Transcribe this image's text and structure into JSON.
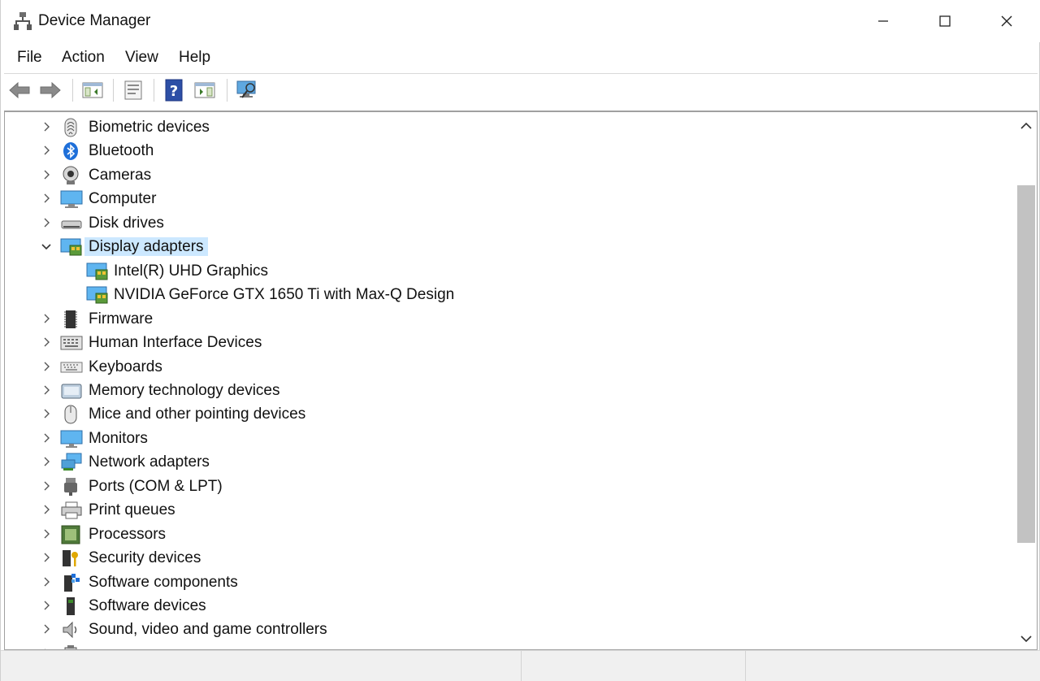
{
  "window": {
    "title": "Device Manager"
  },
  "menu": {
    "file": "File",
    "action": "Action",
    "view": "View",
    "help": "Help"
  },
  "toolbar_icons": [
    "back-arrow-icon",
    "forward-arrow-icon",
    "show-hide-console-tree-icon",
    "properties-icon",
    "help-icon",
    "update-driver-icon",
    "scan-hardware-changes-icon"
  ],
  "tree": {
    "categories": [
      {
        "label": "Biometric devices",
        "icon": "fingerprint-icon"
      },
      {
        "label": "Bluetooth",
        "icon": "bluetooth-icon"
      },
      {
        "label": "Cameras",
        "icon": "camera-icon"
      },
      {
        "label": "Computer",
        "icon": "computer-icon"
      },
      {
        "label": "Disk drives",
        "icon": "disk-drive-icon"
      },
      {
        "label": "Display adapters",
        "icon": "display-adapter-icon",
        "expanded": true,
        "selected": true
      },
      {
        "label": "Intel(R) UHD Graphics",
        "icon": "display-adapter-icon",
        "child": true
      },
      {
        "label": "NVIDIA GeForce GTX 1650 Ti with Max-Q Design",
        "icon": "display-adapter-icon",
        "child": true
      },
      {
        "label": "Firmware",
        "icon": "firmware-chip-icon"
      },
      {
        "label": "Human Interface Devices",
        "icon": "hid-keyboard-icon"
      },
      {
        "label": "Keyboards",
        "icon": "keyboard-icon"
      },
      {
        "label": "Memory technology devices",
        "icon": "memory-card-icon"
      },
      {
        "label": "Mice and other pointing devices",
        "icon": "mouse-icon"
      },
      {
        "label": "Monitors",
        "icon": "monitor-icon"
      },
      {
        "label": "Network adapters",
        "icon": "network-adapter-icon"
      },
      {
        "label": "Ports (COM & LPT)",
        "icon": "port-icon"
      },
      {
        "label": "Print queues",
        "icon": "printer-icon"
      },
      {
        "label": "Processors",
        "icon": "processor-icon"
      },
      {
        "label": "Security devices",
        "icon": "security-key-icon"
      },
      {
        "label": "Software components",
        "icon": "software-component-icon"
      },
      {
        "label": "Software devices",
        "icon": "software-device-icon"
      },
      {
        "label": "Sound, video and game controllers",
        "icon": "speaker-icon"
      },
      {
        "label": "",
        "icon": "storage-controller-icon",
        "partial": true
      }
    ]
  },
  "colors": {
    "selection": "#cce8ff",
    "scroll_thumb": "#c2c2c2",
    "status_bar": "#f0f0f0"
  }
}
